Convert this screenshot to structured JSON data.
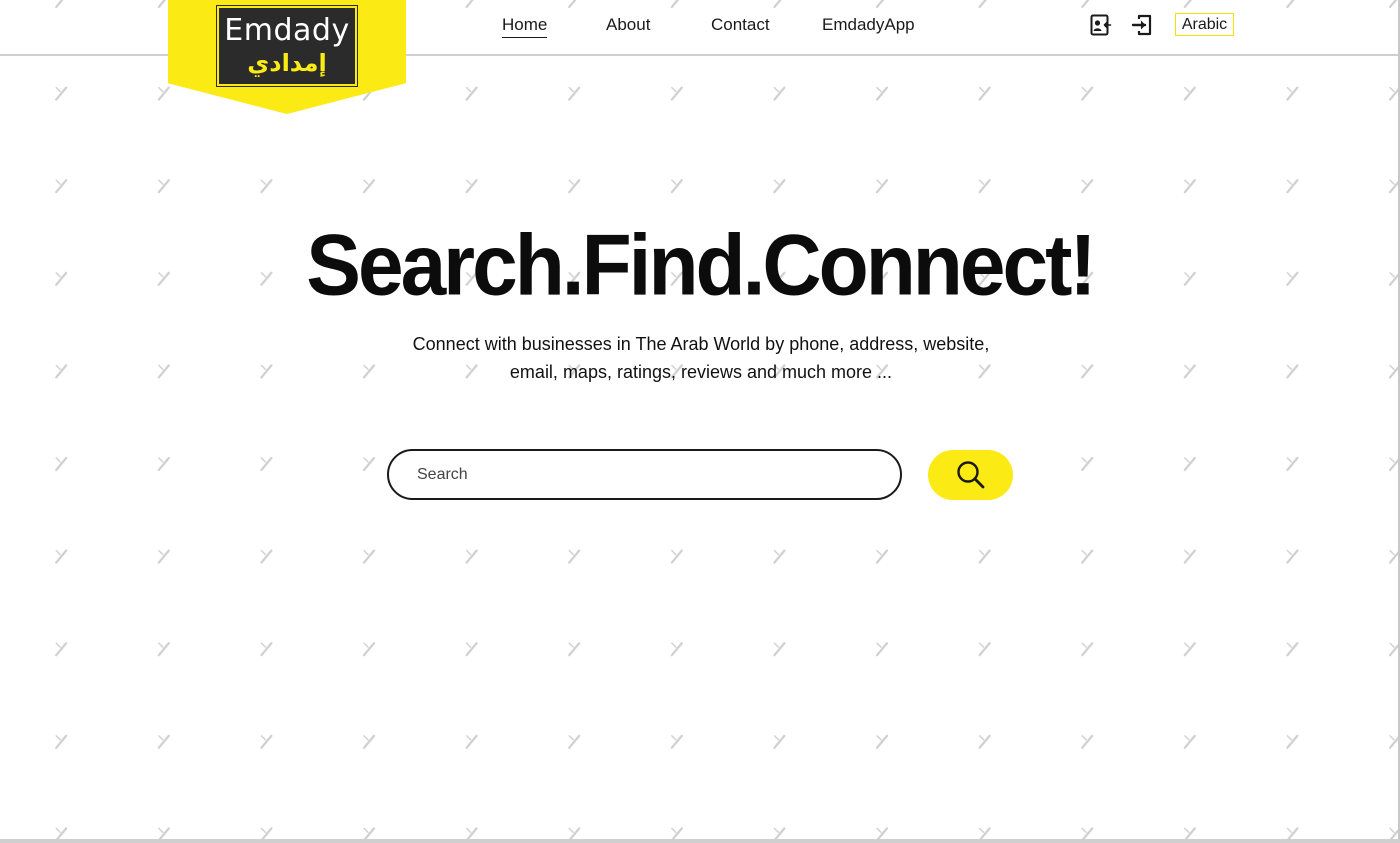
{
  "brand": {
    "name_en": "Emdady",
    "name_ar": "إمدادي",
    "accent_color": "#fcea14",
    "logo_bg_color": "#2b2b2b"
  },
  "nav": {
    "items": [
      {
        "label": "Home",
        "active": true
      },
      {
        "label": "About",
        "active": false
      },
      {
        "label": "Contact",
        "active": false
      },
      {
        "label": "EmdadyApp",
        "active": false
      }
    ],
    "icons": [
      "contact-card-icon",
      "sign-in-icon"
    ],
    "language_label": "Arabic"
  },
  "hero": {
    "title": "Search.Find.Connect!",
    "subtitle_line1": "Connect with businesses in The Arab World by phone, address, website,",
    "subtitle_line2": "email, maps, ratings, reviews and much more ..."
  },
  "search": {
    "placeholder": "Search",
    "value": "",
    "button_icon": "search-icon"
  }
}
